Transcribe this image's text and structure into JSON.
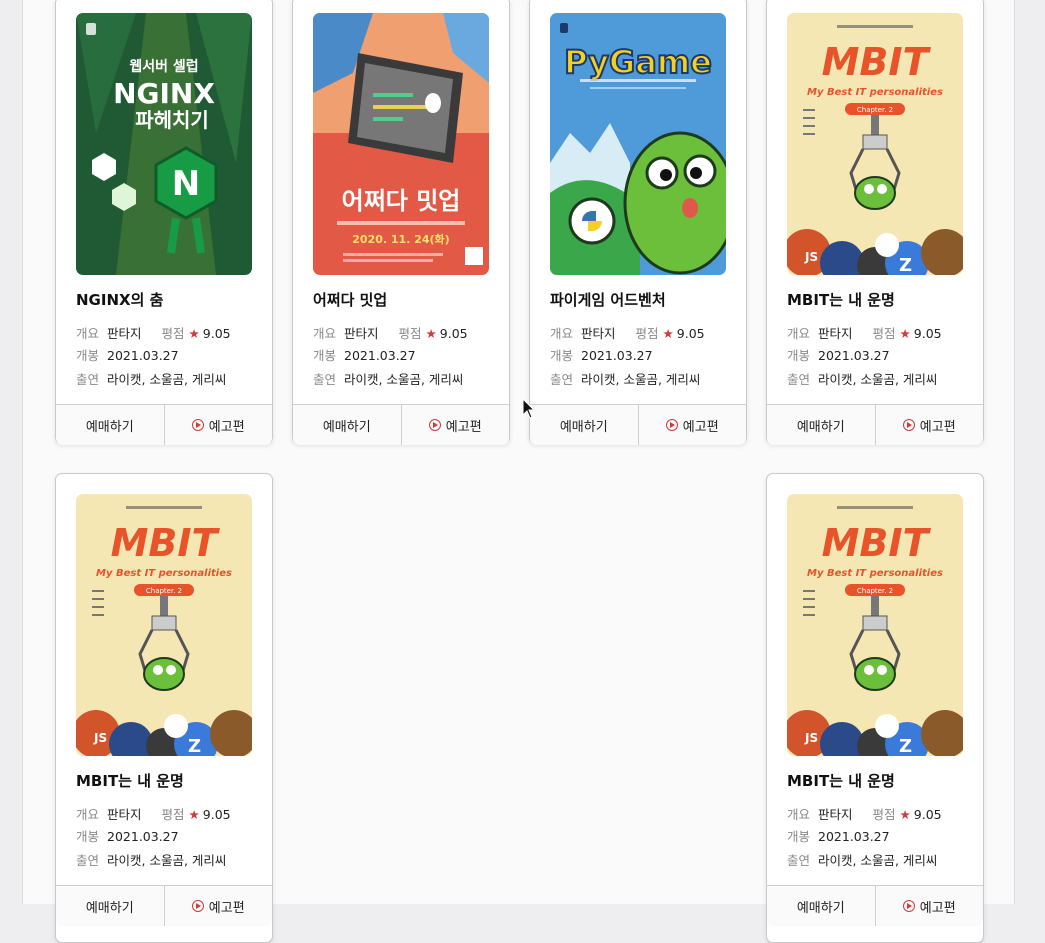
{
  "movies": [
    {
      "title": "NGINX의 춤",
      "summary_label": "개요",
      "summary": "판타지",
      "rating_label": "평점",
      "rating": "9.05",
      "release_label": "개봉",
      "release": "2021.03.27",
      "cast_label": "출연",
      "cast": "라이캣, 소울곰, 게리씨",
      "book_label": "예매하기",
      "trailer_label": "예고편",
      "poster": {
        "line1": "웹서버 셀럽",
        "line2": "NGINX",
        "line3": "파헤치기"
      }
    },
    {
      "title": "어쩌다 밋업",
      "summary_label": "개요",
      "summary": "판타지",
      "rating_label": "평점",
      "rating": "9.05",
      "release_label": "개봉",
      "release": "2021.03.27",
      "cast_label": "출연",
      "cast": "라이캣, 소울곰, 게리씨",
      "book_label": "예매하기",
      "trailer_label": "예고편",
      "poster": {
        "headline": "어쩌다 밋업",
        "date": "2020. 11. 24(화)"
      }
    },
    {
      "title": "파이게임 어드벤처",
      "summary_label": "개요",
      "summary": "판타지",
      "rating_label": "평점",
      "rating": "9.05",
      "release_label": "개봉",
      "release": "2021.03.27",
      "cast_label": "출연",
      "cast": "라이캣, 소울곰, 게리씨",
      "book_label": "예매하기",
      "trailer_label": "예고편",
      "poster": {
        "headline": "PyGame"
      }
    },
    {
      "title": "MBIT는 내 운명",
      "summary_label": "개요",
      "summary": "판타지",
      "rating_label": "평점",
      "rating": "9.05",
      "release_label": "개봉",
      "release": "2021.03.27",
      "cast_label": "출연",
      "cast": "라이캣, 소울곰, 게리씨",
      "book_label": "예매하기",
      "trailer_label": "예고편",
      "poster": {
        "headline": "MBIT",
        "sub": "My Best IT personalities",
        "chapter": "Chapter. 2"
      }
    },
    {
      "title": "MBIT는 내 운명",
      "summary_label": "개요",
      "summary": "판타지",
      "rating_label": "평점",
      "rating": "9.05",
      "release_label": "개봉",
      "release": "2021.03.27",
      "cast_label": "출연",
      "cast": "라이캣, 소울곰, 게리씨",
      "book_label": "예매하기",
      "trailer_label": "예고편",
      "poster": {
        "headline": "MBIT",
        "sub": "My Best IT personalities",
        "chapter": "Chapter. 2"
      }
    },
    {
      "title": "MBIT는 내 운명",
      "summary_label": "개요",
      "summary": "판타지",
      "rating_label": "평점",
      "rating": "9.05",
      "release_label": "개봉",
      "release": "2021.03.27",
      "cast_label": "출연",
      "cast": "라이캣, 소울곰, 게리씨",
      "book_label": "예매하기",
      "trailer_label": "예고편",
      "poster": {
        "headline": "MBIT",
        "sub": "My Best IT personalities",
        "chapter": "Chapter. 2"
      }
    }
  ],
  "colors": {
    "accent": "#d33a3a",
    "star": "#d33a3a"
  },
  "icons": {
    "rating": "star-icon",
    "trailer": "play-circle-icon"
  }
}
